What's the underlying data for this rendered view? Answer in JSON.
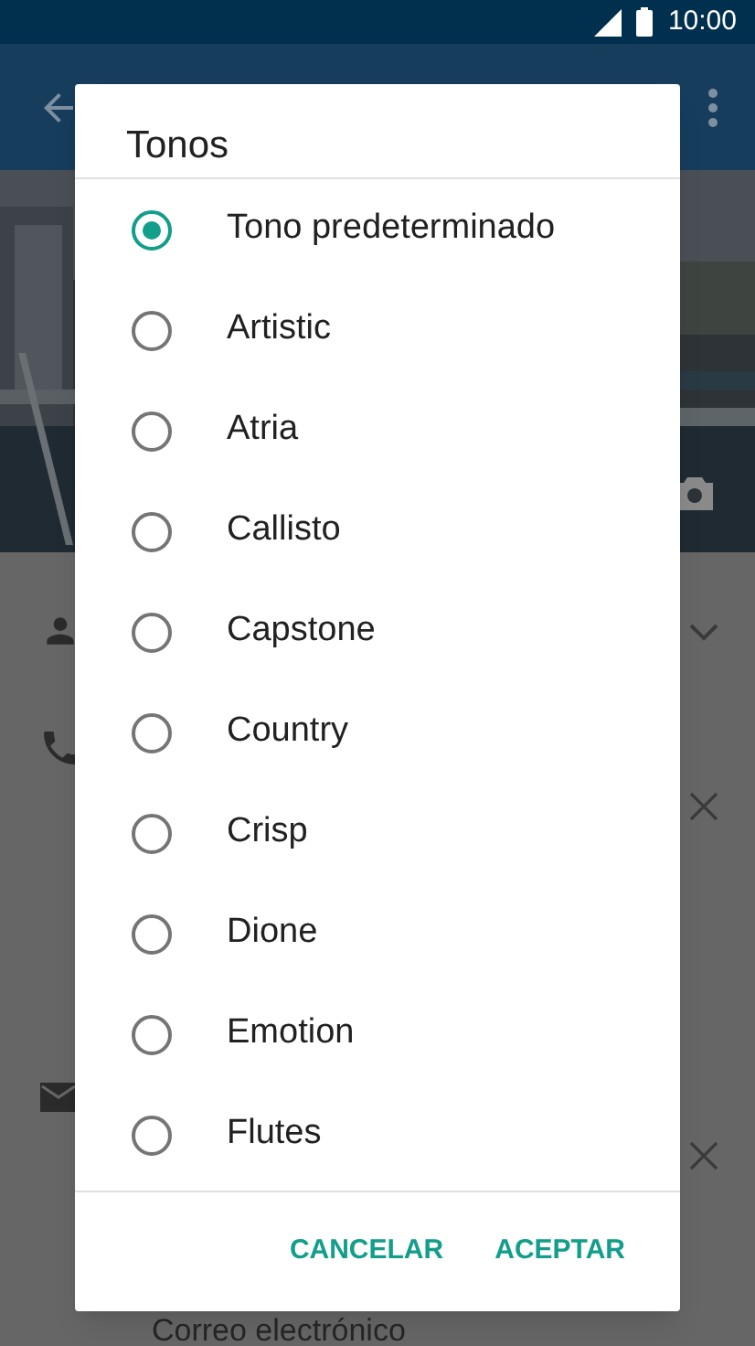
{
  "status_bar": {
    "time": "10:00"
  },
  "background": {
    "email_label": "Correo electrónico"
  },
  "dialog": {
    "title": "Tonos",
    "options": [
      {
        "label": "Tono predeterminado",
        "selected": true
      },
      {
        "label": "Artistic",
        "selected": false
      },
      {
        "label": "Atria",
        "selected": false
      },
      {
        "label": "Callisto",
        "selected": false
      },
      {
        "label": "Capstone",
        "selected": false
      },
      {
        "label": "Country",
        "selected": false
      },
      {
        "label": "Crisp",
        "selected": false
      },
      {
        "label": "Dione",
        "selected": false
      },
      {
        "label": "Emotion",
        "selected": false
      },
      {
        "label": "Flutes",
        "selected": false
      }
    ],
    "buttons": [
      "CANCELAR",
      "ACEPTAR"
    ]
  }
}
